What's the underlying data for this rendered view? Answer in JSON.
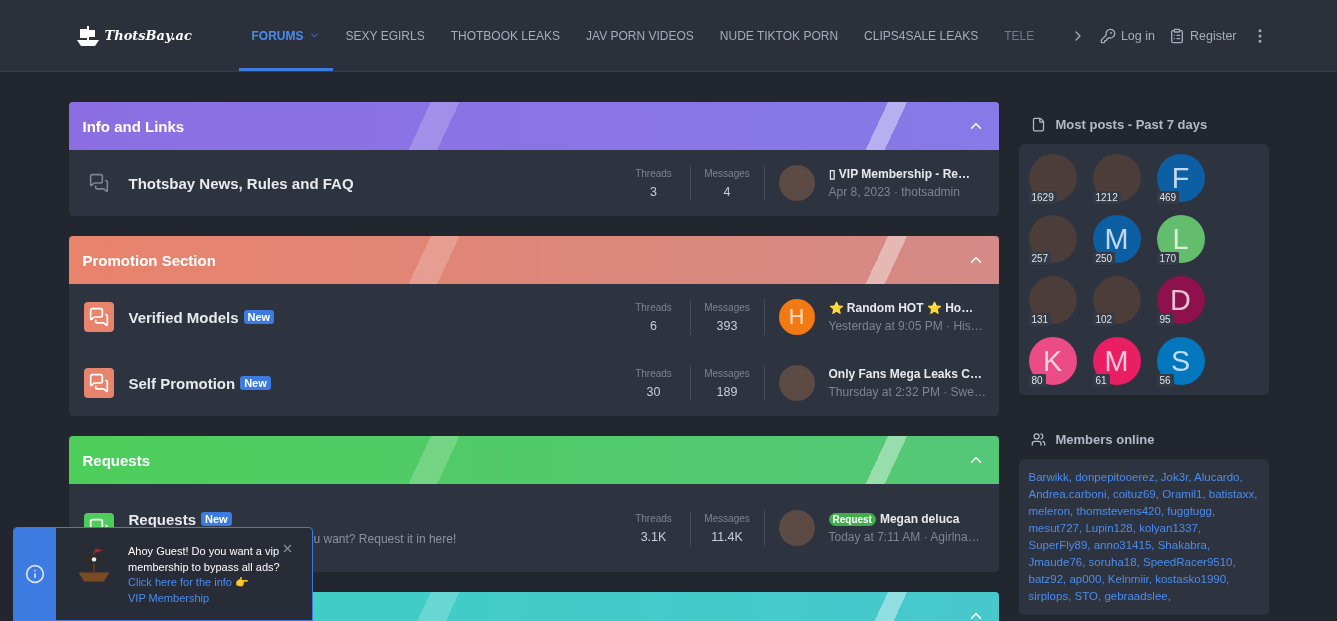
{
  "header": {
    "logo": "ThotsBay.ac",
    "nav": [
      {
        "label": "FORUMS",
        "selected": true
      },
      {
        "label": "SEXY EGIRLS",
        "selected": false
      },
      {
        "label": "THOTBOOK LEAKS",
        "selected": false
      },
      {
        "label": "JAV PORN VIDEOS",
        "selected": false
      },
      {
        "label": "NUDE TIKTOK PORN",
        "selected": false
      },
      {
        "label": "CLIPS4SALE LEAKS",
        "selected": false
      },
      {
        "label": "TELE",
        "selected": false
      }
    ],
    "login": "Log in",
    "register": "Register"
  },
  "categories": [
    {
      "title": "Info and Links",
      "color": "#8b6fe2",
      "expanded": true,
      "nodes": [
        {
          "title": "Thotsbay News, Rules and FAQ",
          "unread": false,
          "threads_label": "Threads",
          "threads": "3",
          "messages_label": "Messages",
          "messages": "4",
          "last": {
            "kind": "photo",
            "title": "▯ VIP Membership - Re…",
            "meta": "Apr 8, 2023 · thotsadmin"
          }
        }
      ]
    },
    {
      "title": "Promotion Section",
      "color": "#e8836c",
      "expanded": true,
      "nodes": [
        {
          "title": "Verified Models",
          "badge": "New",
          "unread": true,
          "threads_label": "Threads",
          "threads": "6",
          "messages_label": "Messages",
          "messages": "393",
          "last": {
            "kind": "letter",
            "letter": "H",
            "color": "#f27a14",
            "title": "⭐ Random HOT ⭐ Ho…",
            "meta": "Yesterday at 9:05 PM · His…"
          }
        },
        {
          "title": "Self Promotion",
          "badge": "New",
          "unread": true,
          "threads_label": "Threads",
          "threads": "30",
          "messages_label": "Messages",
          "messages": "189",
          "last": {
            "kind": "photo",
            "title": "Only Fans Mega Leaks C…",
            "meta": "Thursday at 2:32 PM · Swe…"
          }
        }
      ]
    },
    {
      "title": "Requests",
      "color": "#4dce5b",
      "expanded": true,
      "nodes": [
        {
          "title": "Requests",
          "badge": "New",
          "unread": true,
          "description": "u want? Request it in here!",
          "threads_label": "Threads",
          "threads": "3.1K",
          "messages_label": "Messages",
          "messages": "11.4K",
          "last": {
            "kind": "photo",
            "prefix": "Request",
            "title": "Megan deluca",
            "meta": "Today at 7:11 AM · Agirlna…"
          }
        }
      ]
    },
    {
      "color": "#3ecfc3",
      "expanded": true
    }
  ],
  "sidebar": {
    "most_posts": {
      "title": "Most posts - Past 7 days",
      "members": [
        {
          "kind": "photo",
          "count": "1629"
        },
        {
          "kind": "photo",
          "count": "1212"
        },
        {
          "kind": "letter",
          "letter": "F",
          "color": "#0d5fa3",
          "count": "469"
        },
        {
          "kind": "photo",
          "count": "257"
        },
        {
          "kind": "letter",
          "letter": "M",
          "color": "#0d5fa3",
          "count": "250"
        },
        {
          "kind": "letter",
          "letter": "L",
          "color": "#63bd6c",
          "count": "170"
        },
        {
          "kind": "photo",
          "count": "131"
        },
        {
          "kind": "photo",
          "count": "102"
        },
        {
          "kind": "letter",
          "letter": "D",
          "color": "#8e104c",
          "count": "95"
        },
        {
          "kind": "letter",
          "letter": "K",
          "color": "#ec4c85",
          "count": "80"
        },
        {
          "kind": "letter",
          "letter": "M",
          "color": "#e91e63",
          "count": "61"
        },
        {
          "kind": "letter",
          "letter": "S",
          "color": "#0277bd",
          "count": "56"
        }
      ]
    },
    "members_online": {
      "title": "Members online",
      "names": [
        "Barwikk,",
        "donpepitooerez,",
        "Jok3r,",
        "Alucardo,",
        "Andrea.carboni,",
        "coituz69,",
        "Oramil1,",
        "batistaxx,",
        "meleron,",
        "thomstevens420,",
        "fuggtugg,",
        "mesut727,",
        "Lupin128,",
        "kolyan1337,",
        "SuperFly89,",
        "anno31415,",
        "Shakabra,",
        "Jmaude76,",
        "soruha18,",
        "SpeedRacer9510,",
        "batz92,",
        "ap000,",
        "Kelnmiir,",
        "kostasko1990,",
        "sirplops,",
        "STO,",
        "gebraadslee,"
      ]
    }
  },
  "notice": {
    "text": "Ahoy Guest! Do you want a vip membership to bypass all ads?",
    "link": "Click here for the info 👉",
    "link2": "VIP Membership"
  }
}
